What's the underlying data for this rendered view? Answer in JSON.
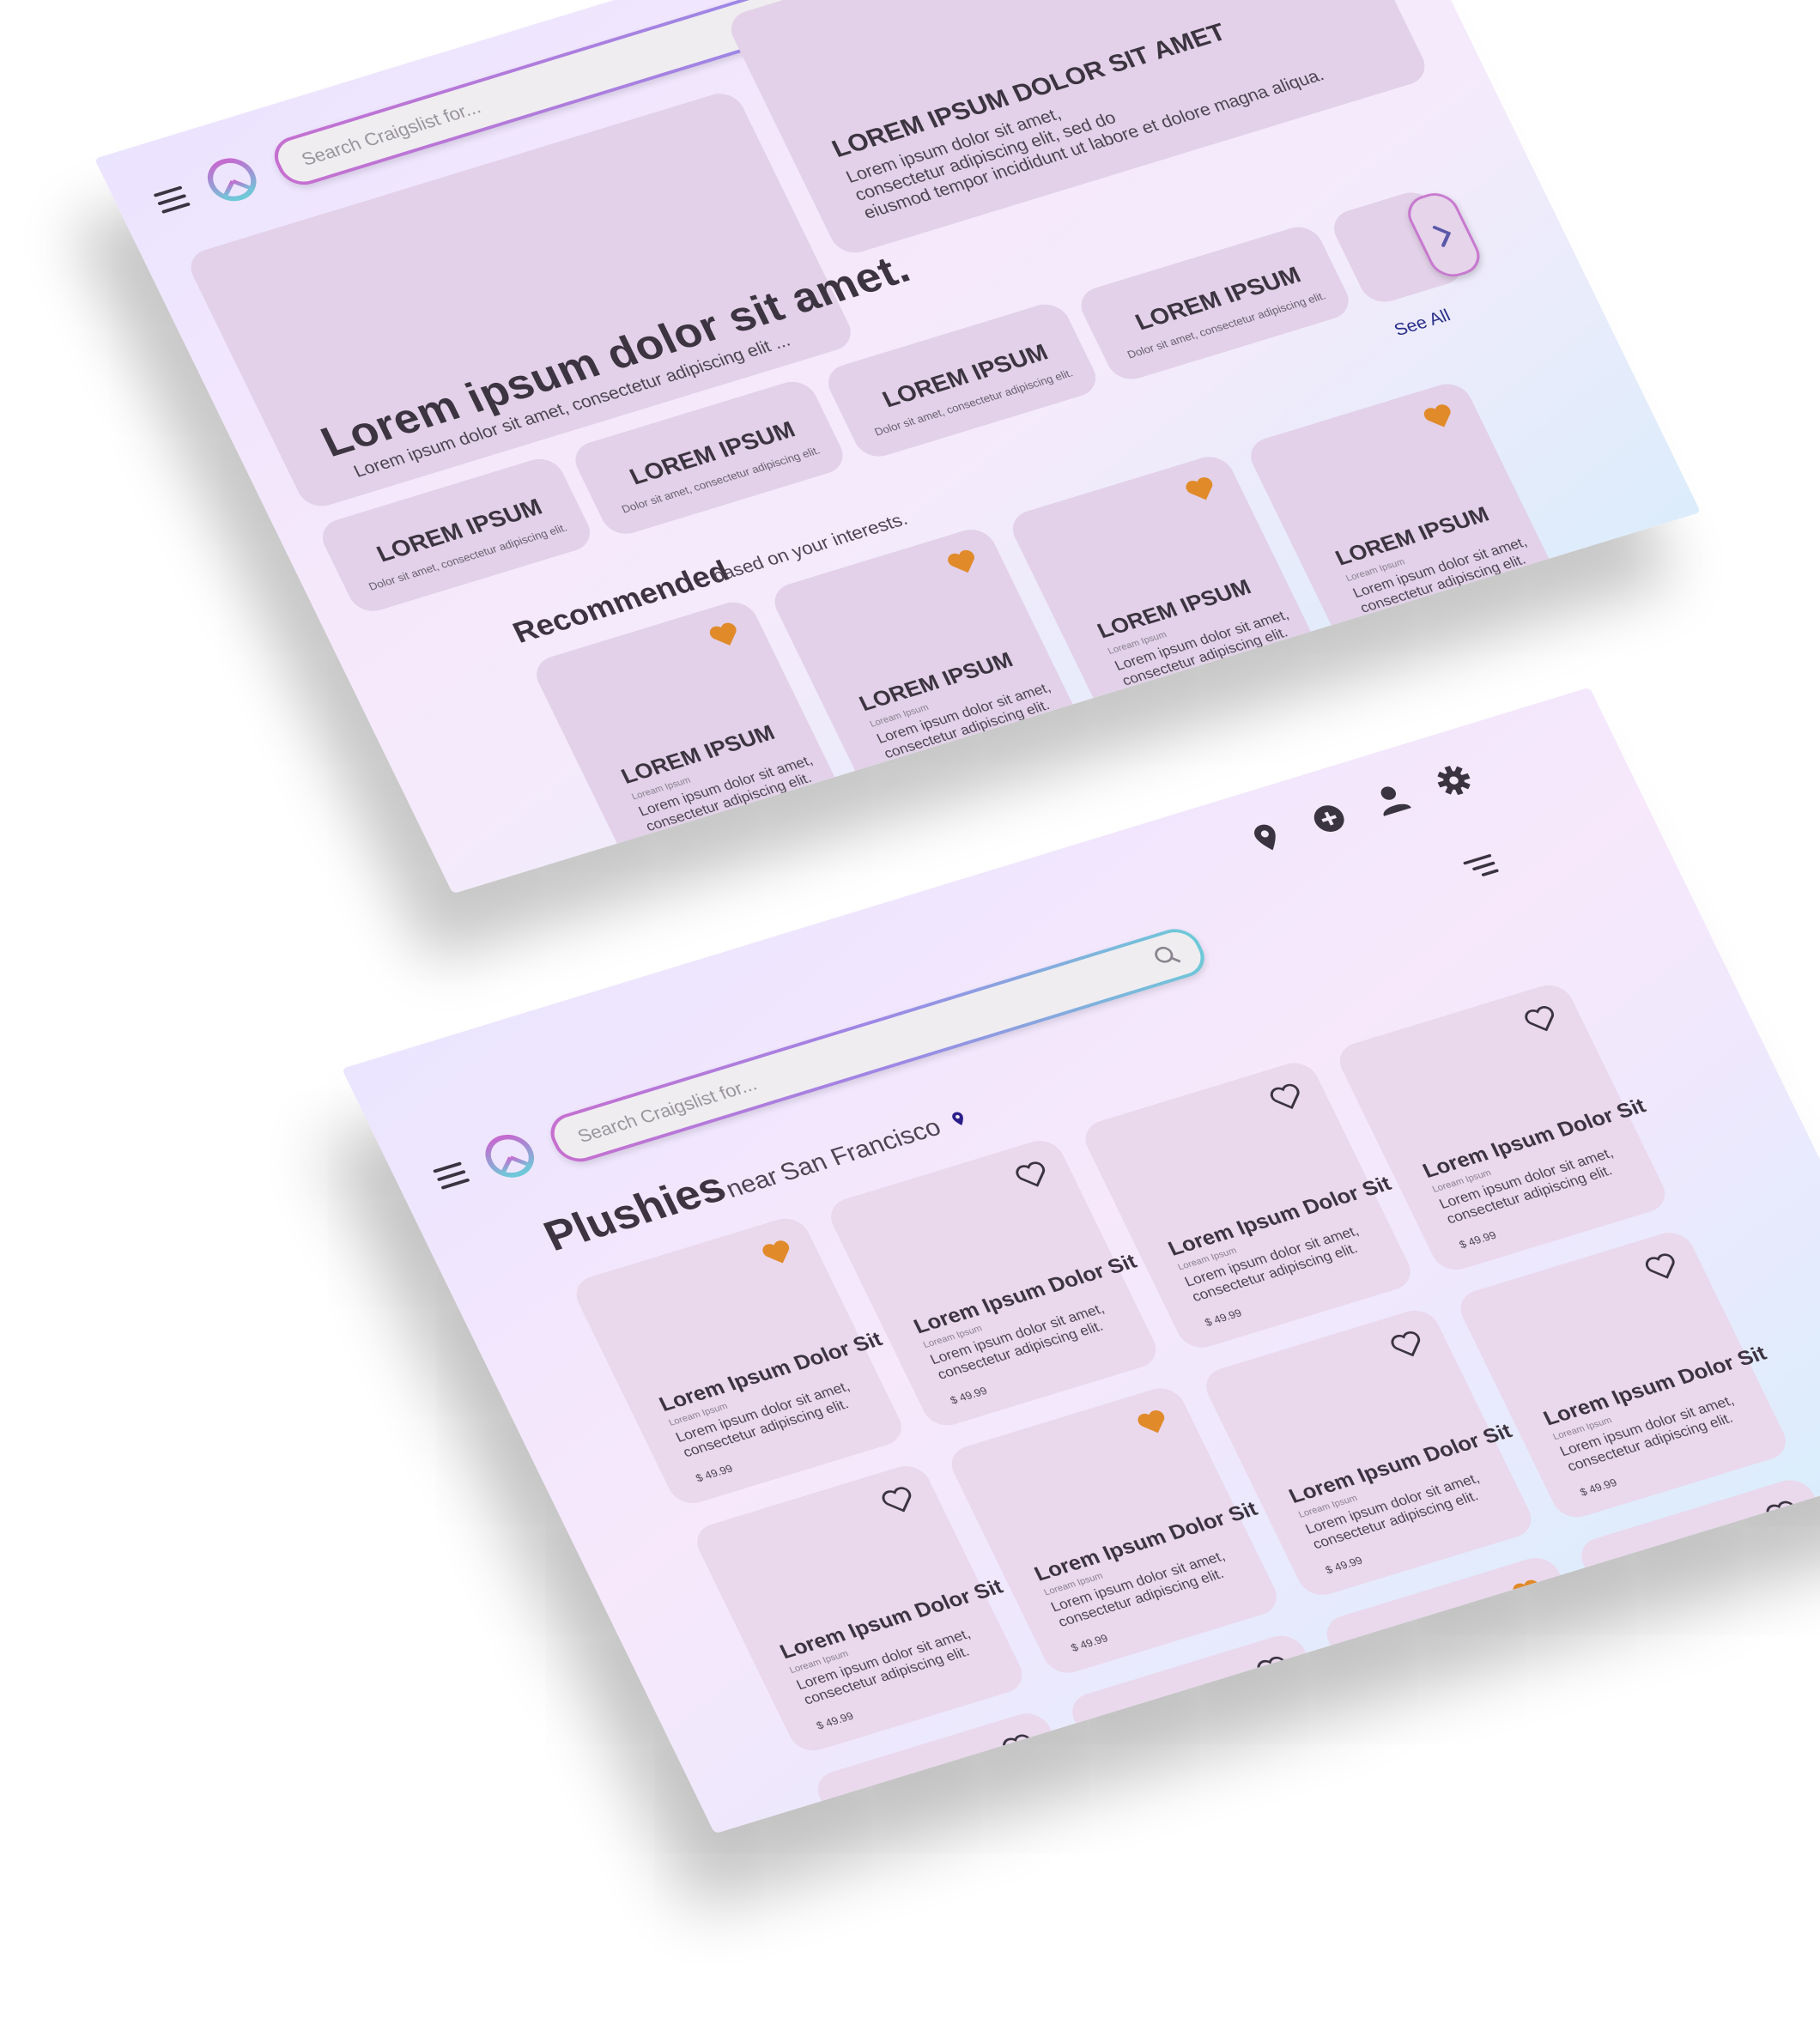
{
  "top_screen": {
    "search_placeholder": "Search Craigslist for...",
    "hero_left": {
      "title": "Lorem ipsum dolor sit amet.",
      "subtitle": "Lorem ipsum dolor sit amet, consectetur adipiscing elit ..."
    },
    "hero_right": {
      "title": "LOREM IPSUM DOLOR SIT AMET",
      "line1": "Lorem ipsum dolor sit amet,",
      "line2": "consectetur adipiscing elit, sed do",
      "line3": "eiusmod tempor incididunt ut labore et dolore magna aliqua."
    },
    "categories": [
      {
        "title": "LOREM IPSUM",
        "desc": "Dolor sit amet, consectetur adipiscing elit."
      },
      {
        "title": "LOREM IPSUM",
        "desc": "Dolor sit amet, consectetur adipiscing elit."
      },
      {
        "title": "LOREM IPSUM",
        "desc": "Dolor sit amet, consectetur adipiscing elit."
      },
      {
        "title": "LOREM IPSUM",
        "desc": "Dolor sit amet, consectetur adipiscing elit."
      }
    ],
    "see_all": "See All",
    "recommended_title": "Recommended",
    "recommended_sub": "based on your interests.",
    "rec_items": [
      {
        "title": "LOREM IPSUM",
        "tag": "Loream Ipsum",
        "desc1": "Lorem ipsum dolor sit amet,",
        "desc2": "consectetur adipiscing elit."
      },
      {
        "title": "LOREM IPSUM",
        "tag": "Loream Ipsum",
        "desc1": "Lorem ipsum dolor sit amet,",
        "desc2": "consectetur adipiscing elit."
      },
      {
        "title": "LOREM IPSUM",
        "tag": "Loream Ipsum",
        "desc1": "Lorem ipsum dolor sit amet,",
        "desc2": "consectetur adipiscing elit."
      },
      {
        "title": "LOREM IPSUM",
        "tag": "Loream Ipsum",
        "desc1": "Lorem ipsum dolor sit amet,",
        "desc2": "consectetur adipiscing elit."
      }
    ],
    "next_icon": "chevron-right-icon",
    "colors": {
      "card": "#e2d1e8",
      "heart": "#e08a2a"
    }
  },
  "bottom_screen": {
    "search_placeholder": "Search Craigslist for...",
    "page_title": "Plushies",
    "location_prefix": "near",
    "location": "San Francisco",
    "icons": [
      "location-pin-icon",
      "plus-circle-icon",
      "user-icon",
      "gear-icon",
      "filter-icon",
      "search-icon"
    ],
    "products": [
      {
        "title": "Lorem Ipsum Dolor Sit",
        "tag": "Loream Ipsum",
        "desc1": "Lorem ipsum dolor sit amet,",
        "desc2": "consectetur adipiscing elit.",
        "price": "$ 49.99",
        "favorite": true
      },
      {
        "title": "Lorem Ipsum Dolor Sit",
        "tag": "Loream Ipsum",
        "desc1": "Lorem ipsum dolor sit amet,",
        "desc2": "consectetur adipiscing elit.",
        "price": "$ 49.99",
        "favorite": false
      },
      {
        "title": "Lorem Ipsum Dolor Sit",
        "tag": "Loream Ipsum",
        "desc1": "Lorem ipsum dolor sit amet,",
        "desc2": "consectetur adipiscing elit.",
        "price": "$ 49.99",
        "favorite": false
      },
      {
        "title": "Lorem Ipsum Dolor Sit",
        "tag": "Loream Ipsum",
        "desc1": "Lorem ipsum dolor sit amet,",
        "desc2": "consectetur adipiscing elit.",
        "price": "$ 49.99",
        "favorite": false
      },
      {
        "title": "Lorem Ipsum Dolor Sit",
        "tag": "Loream Ipsum",
        "desc1": "Lorem ipsum dolor sit amet,",
        "desc2": "consectetur adipiscing elit.",
        "price": "$ 49.99",
        "favorite": false
      },
      {
        "title": "Lorem Ipsum Dolor Sit",
        "tag": "Loream Ipsum",
        "desc1": "Lorem ipsum dolor sit amet,",
        "desc2": "consectetur adipiscing elit.",
        "price": "$ 49.99",
        "favorite": true
      },
      {
        "title": "Lorem Ipsum Dolor Sit",
        "tag": "Loream Ipsum",
        "desc1": "Lorem ipsum dolor sit amet,",
        "desc2": "consectetur adipiscing elit.",
        "price": "$ 49.99",
        "favorite": false
      },
      {
        "title": "Lorem Ipsum Dolor Sit",
        "tag": "Loream Ipsum",
        "desc1": "Lorem ipsum dolor sit amet,",
        "desc2": "consectetur adipiscing elit.",
        "price": "$ 49.99",
        "favorite": false
      }
    ],
    "partial_row_favorites": [
      false,
      false,
      true,
      false
    ],
    "colors": {
      "card": "#ead8ec",
      "heart": "#e08a2a",
      "pin": "#2a1f8a"
    }
  }
}
